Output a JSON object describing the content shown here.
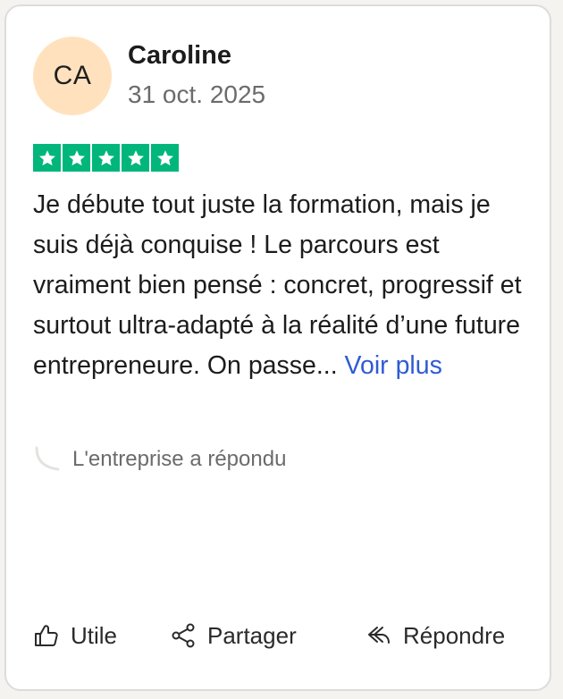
{
  "reviewer": {
    "initials": "CA",
    "name": "Caroline",
    "date": "31 oct. 2025"
  },
  "rating": {
    "stars": 5,
    "color": "#00b67a"
  },
  "review": {
    "text": "Je débute tout juste la formation, mais je suis déjà conquise ! Le parcours est vraiment bien pensé : concret, progressif et surtout ultra-adapté à la réalité d’une future entrepreneure. On passe...",
    "more_label": "Voir plus"
  },
  "company_reply": {
    "label": "L'entreprise a répondu"
  },
  "actions": {
    "useful_label": "Utile",
    "share_label": "Partager",
    "reply_label": "Répondre"
  },
  "colors": {
    "avatar_bg": "#ffe2bd",
    "link": "#2f5bd3",
    "muted_text": "#6b6b6b"
  },
  "icons": {
    "useful": "thumbs-up-icon",
    "share": "share-icon",
    "reply": "reply-icon",
    "star": "star-icon",
    "company_reply": "reply-curve-icon"
  }
}
